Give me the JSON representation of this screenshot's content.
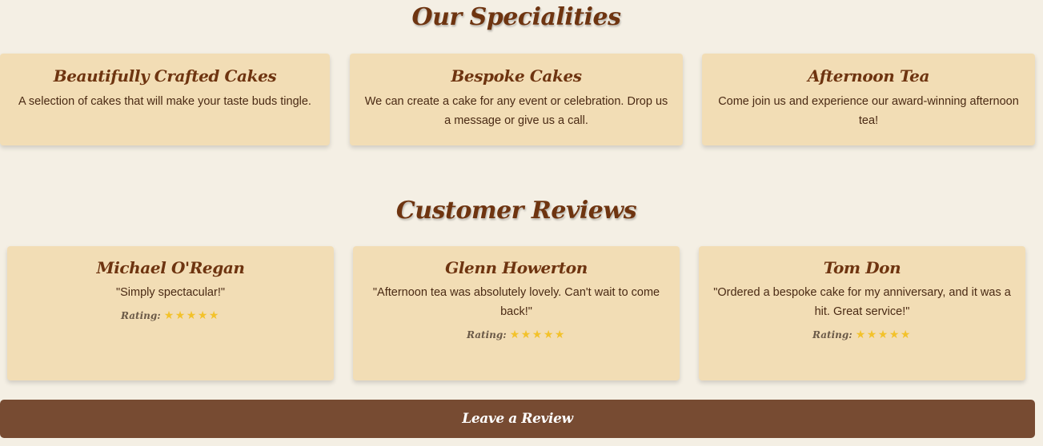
{
  "specialities": {
    "title": "Our Specialities",
    "items": [
      {
        "title": "Beautifully Crafted Cakes",
        "description": "A selection of cakes that will make your taste buds tingle."
      },
      {
        "title": "Bespoke Cakes",
        "description": "We can create a cake for any event or celebration. Drop us a message or give us a call."
      },
      {
        "title": "Afternoon Tea",
        "description": "Come join us and experience our award-winning afternoon tea!"
      }
    ]
  },
  "reviews": {
    "title": "Customer Reviews",
    "rating_label": "Rating:",
    "items": [
      {
        "name": "Michael O'Regan",
        "quote": "\"Simply spectacular!\"",
        "stars": "★★★★★",
        "rating": 5
      },
      {
        "name": "Glenn Howerton",
        "quote": "\"Afternoon tea was absolutely lovely. Can't wait to come back!\"",
        "stars": "★★★★★",
        "rating": 5
      },
      {
        "name": "Tom Don",
        "quote": "\"Ordered a bespoke cake for my anniversary, and it was a hit. Great service!\"",
        "stars": "★★★★★",
        "rating": 5
      }
    ]
  },
  "leave_review_label": "Leave a Review",
  "colors": {
    "background": "#f4efe4",
    "card": "#f2ddb5",
    "heading": "#6e3410",
    "button": "#774b32",
    "star": "#f3c22b"
  }
}
